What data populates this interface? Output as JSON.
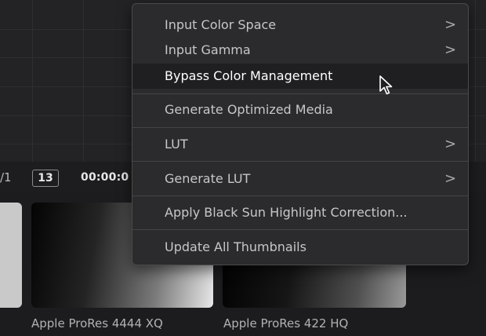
{
  "timeline": {
    "slash_text": "/1",
    "frame_number": "13",
    "timecode": "00:00:0"
  },
  "thumbnails": [
    {
      "label": ""
    },
    {
      "label": "Apple ProRes 4444 XQ"
    },
    {
      "label": "Apple ProRes 422 HQ"
    }
  ],
  "menu": {
    "items": [
      {
        "label": "Input Color Space",
        "submenu": true,
        "highlighted": false
      },
      {
        "label": "Input Gamma",
        "submenu": true,
        "highlighted": false
      },
      {
        "label": "Bypass Color Management",
        "submenu": false,
        "highlighted": true
      },
      {
        "label": "Generate Optimized Media",
        "submenu": false,
        "highlighted": false
      },
      {
        "label": "LUT",
        "submenu": true,
        "highlighted": false
      },
      {
        "label": "Generate LUT",
        "submenu": true,
        "highlighted": false
      },
      {
        "label": "Apply Black Sun Highlight Correction...",
        "submenu": false,
        "highlighted": false
      },
      {
        "label": "Update All Thumbnails",
        "submenu": false,
        "highlighted": false
      }
    ],
    "submenu_glyph": ">"
  },
  "cursor": {
    "icon": "arrow-pointer-icon"
  },
  "colors": {
    "menu_bg": "#2b2b2d",
    "highlight_bg": "#1f1f21",
    "text": "#c7c7c7"
  }
}
